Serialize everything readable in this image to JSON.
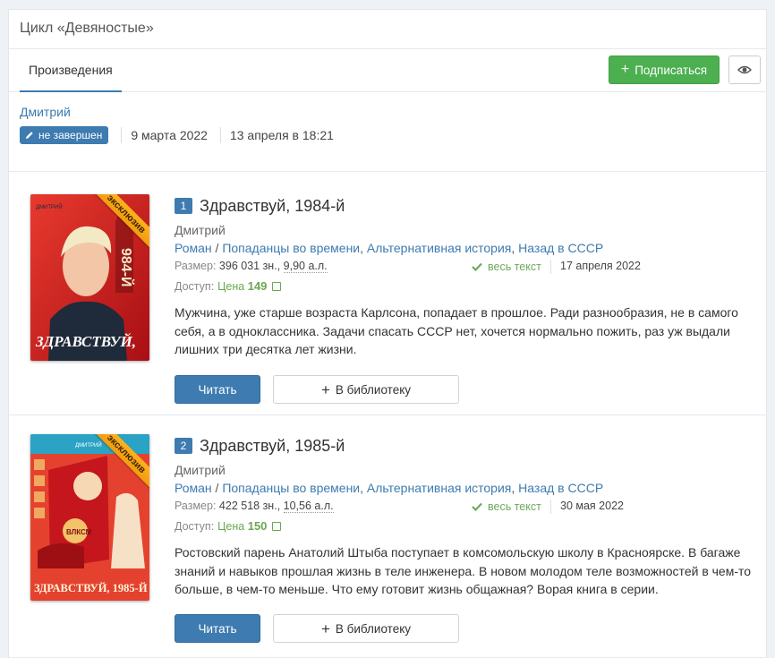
{
  "series": {
    "title": "Цикл «Девяностые»",
    "tab": "Произведения",
    "subscribe_label": "Подписаться",
    "author": "Дмитрий",
    "status_badge": "не завершен",
    "started": "9 марта 2022",
    "updated": "13 апреля в 18:21"
  },
  "labels": {
    "size": "Размер:",
    "access": "Доступ:",
    "price": "Цена",
    "full_text": "весь текст",
    "read": "Читать",
    "add_library": "В библиотеку",
    "ribbon": "эксклюзив"
  },
  "colors": {
    "accent": "#3d7bb0",
    "success": "#4caf50",
    "ribbon": "#f7a21b"
  },
  "works": [
    {
      "number": "1",
      "title": "Здравствуй, 1984-й",
      "author": "Дмитрий",
      "genres": [
        "Роман",
        "Попаданцы во времени",
        "Альтернативная история",
        "Назад в СССР"
      ],
      "chars": "396 031 зн.",
      "sheets": "9,90 а.л.",
      "updated": "17 апреля 2022",
      "price": "149",
      "description": "Мужчина, уже старше возраста Карлсона, попадает в прошлое. Ради разнообразия, не в самого себя, а в одноклассника. Задачи спасать СССР нет, хочется нормально пожить, раз уж выдали лишних три десятка лет жизни.",
      "cover_author": "ДМИТРИЙ",
      "cover_text": "ЗДРАВСТВУЙ,"
    },
    {
      "number": "2",
      "title": "Здравствуй, 1985-й",
      "author": "Дмитрий",
      "genres": [
        "Роман",
        "Попаданцы во времени",
        "Альтернативная история",
        "Назад в СССР"
      ],
      "chars": "422 518 зн.",
      "sheets": "10,56 а.л.",
      "updated": "30 мая 2022",
      "price": "150",
      "description": "Ростовский парень Анатолий Штыба поступает в комсомольскую школу в Красноярске. В багаже знаний и навыков прошлая жизнь в теле инженера. В новом молодом теле возможностей в чем-то больше, в чем-то меньше. Что ему готовит жизнь общажная? Ворая книга в серии.",
      "cover_author": "ДМИТРИЙ",
      "cover_text": "ЗДРАВСТВУЙ, 1985-Й"
    }
  ]
}
